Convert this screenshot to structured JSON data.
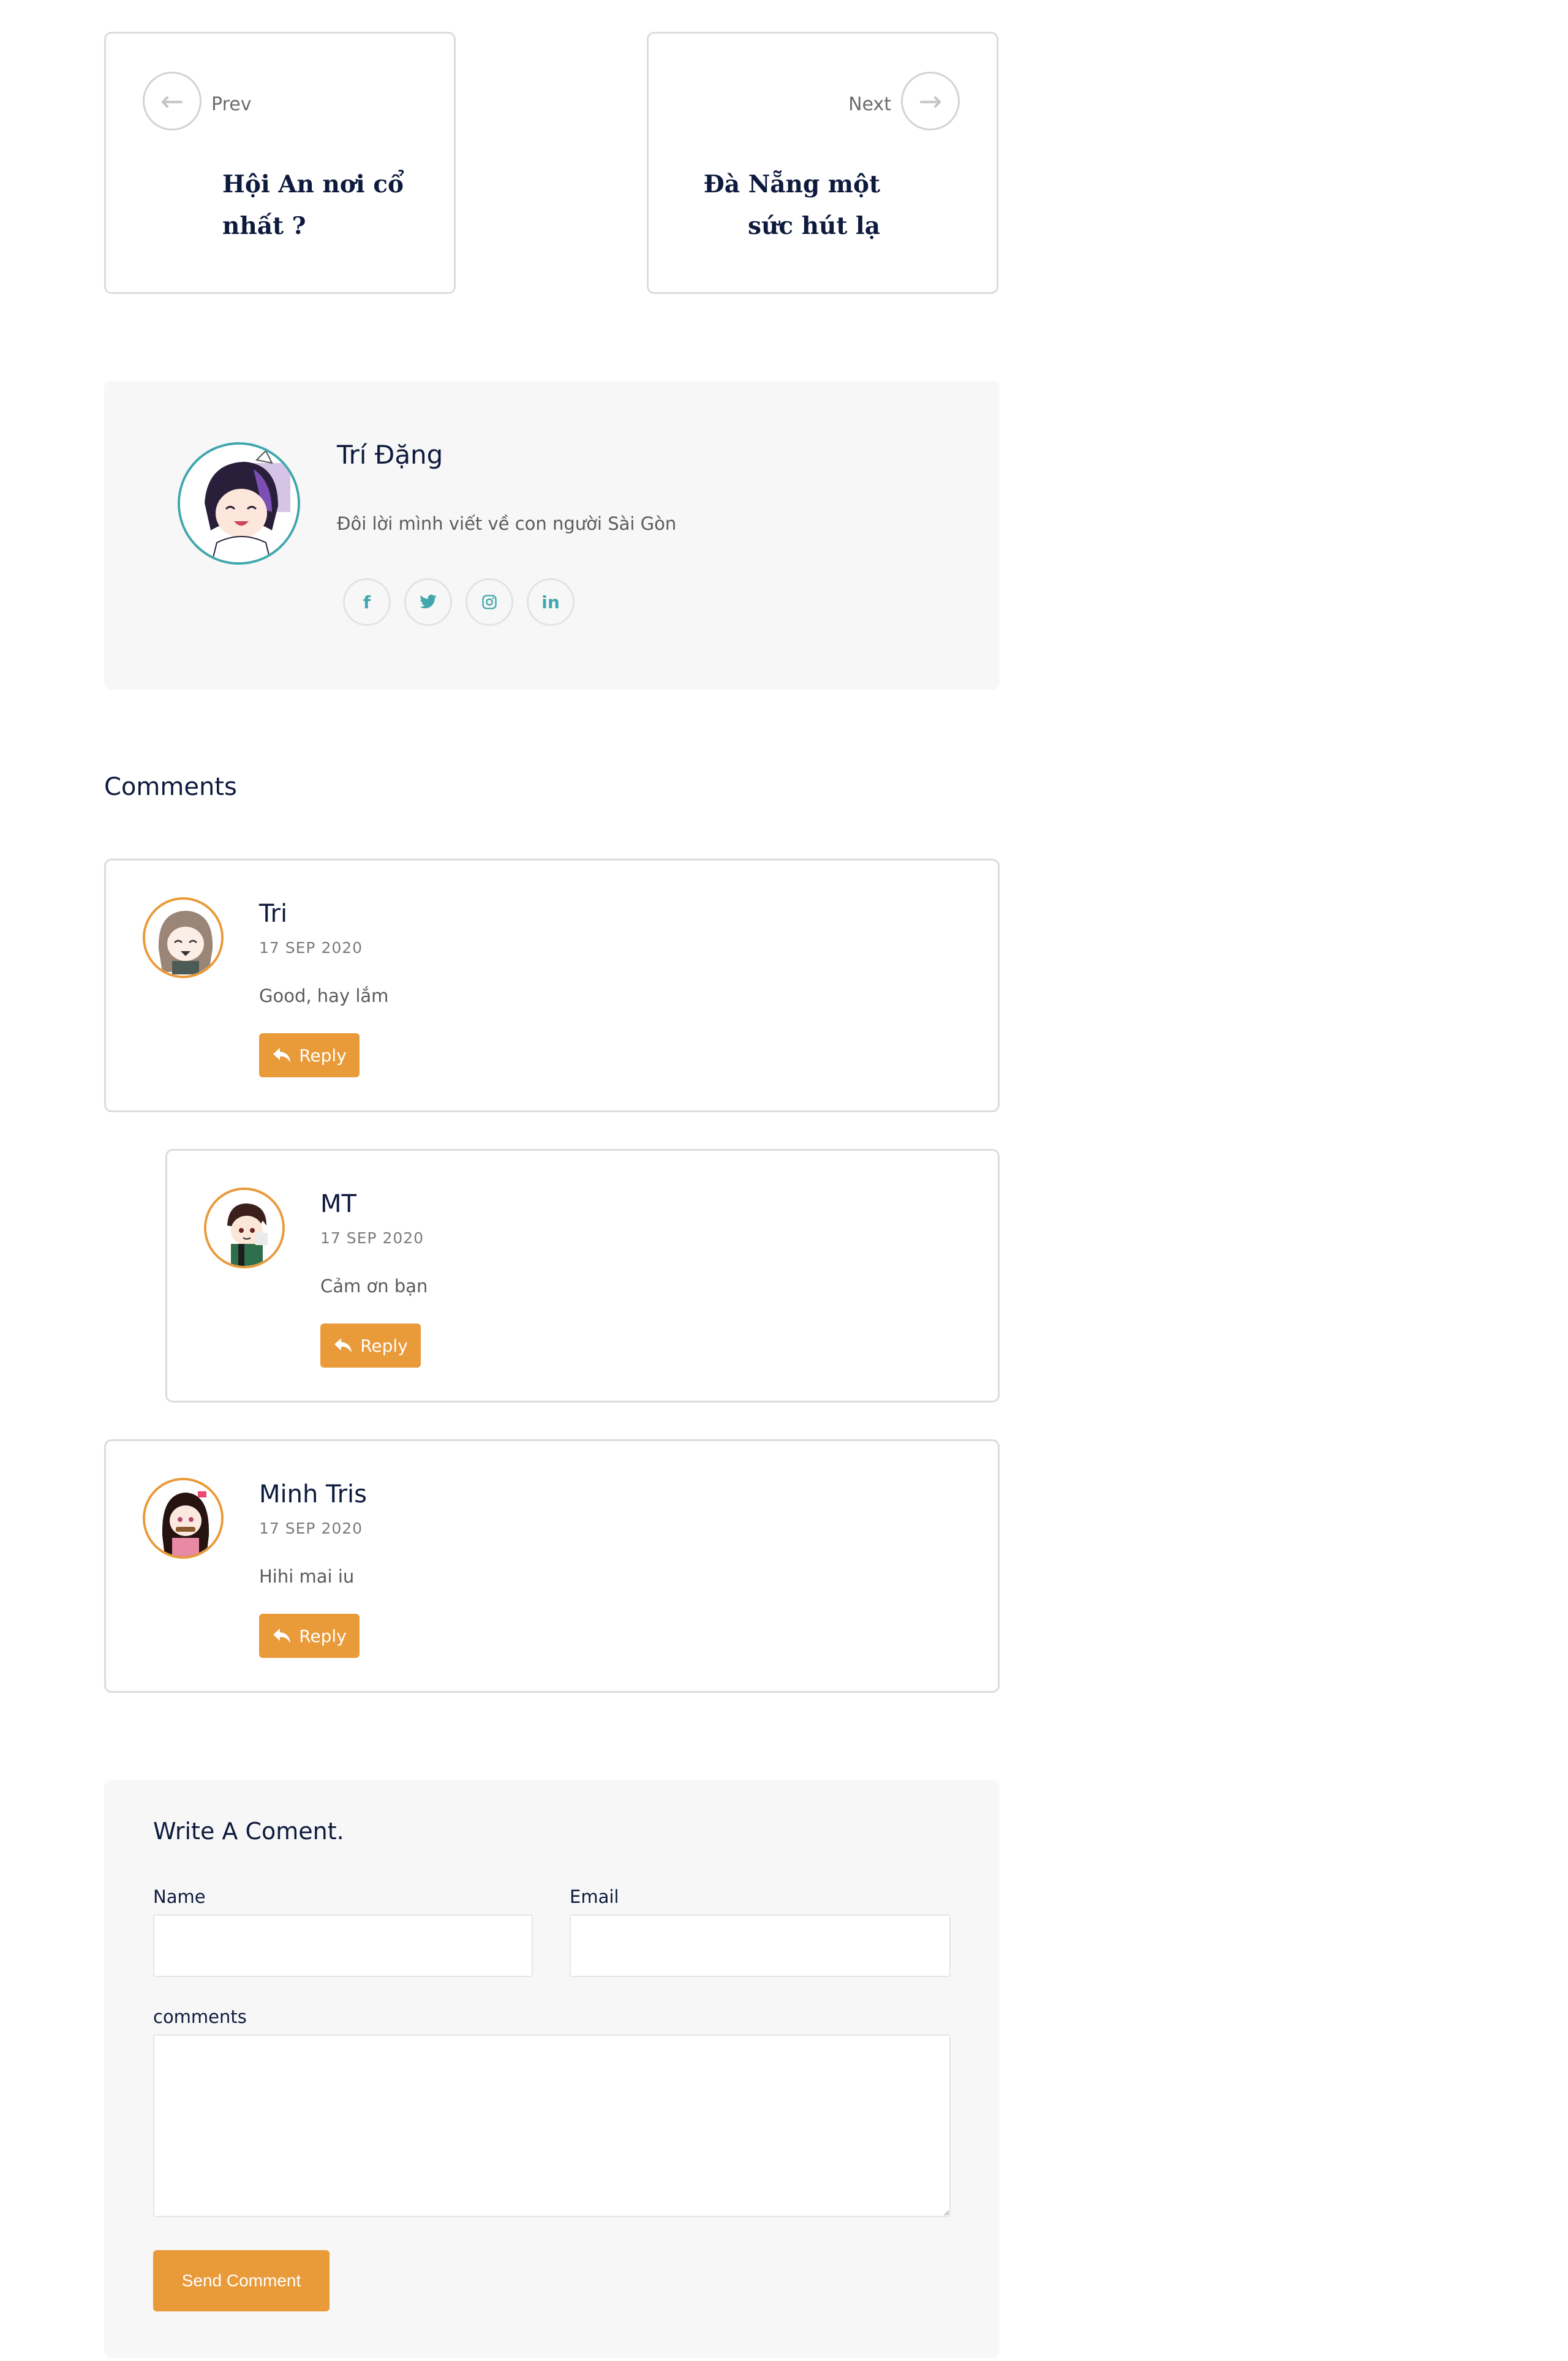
{
  "post_nav": {
    "prev": {
      "label": "Prev",
      "title": "Hội An nơi cổ nhất ?"
    },
    "next": {
      "label": "Next",
      "title": "Đà Nẵng một sức hút lạ"
    }
  },
  "author": {
    "name": "Trí Đặng",
    "bio": "Đôi lời mình viết về con người Sài Gòn",
    "socials": [
      {
        "icon": "facebook-icon",
        "glyph": "f"
      },
      {
        "icon": "twitter-icon",
        "glyph": "t"
      },
      {
        "icon": "instagram-icon",
        "glyph": "◎"
      },
      {
        "icon": "linkedin-icon",
        "glyph": "in"
      }
    ]
  },
  "comments": {
    "heading": "Comments",
    "items": [
      {
        "name": "Tri",
        "date": "17 SEP 2020",
        "text": "Good, hay lắm",
        "reply_label": "Reply"
      },
      {
        "name": "MT",
        "date": "17 SEP 2020",
        "text": "Cảm ơn bạn",
        "reply_label": "Reply"
      },
      {
        "name": "Minh Tris",
        "date": "17 SEP 2020",
        "text": "Hihi mai iu",
        "reply_label": "Reply"
      }
    ]
  },
  "form": {
    "title": "Write A Coment.",
    "name_label": "Name",
    "email_label": "Email",
    "comments_label": "comments",
    "submit_label": "Send Comment"
  },
  "colors": {
    "accent": "#e99a39",
    "teal": "#3fa7ad",
    "navy": "#0e1a3d",
    "panel": "#f7f7f7"
  }
}
